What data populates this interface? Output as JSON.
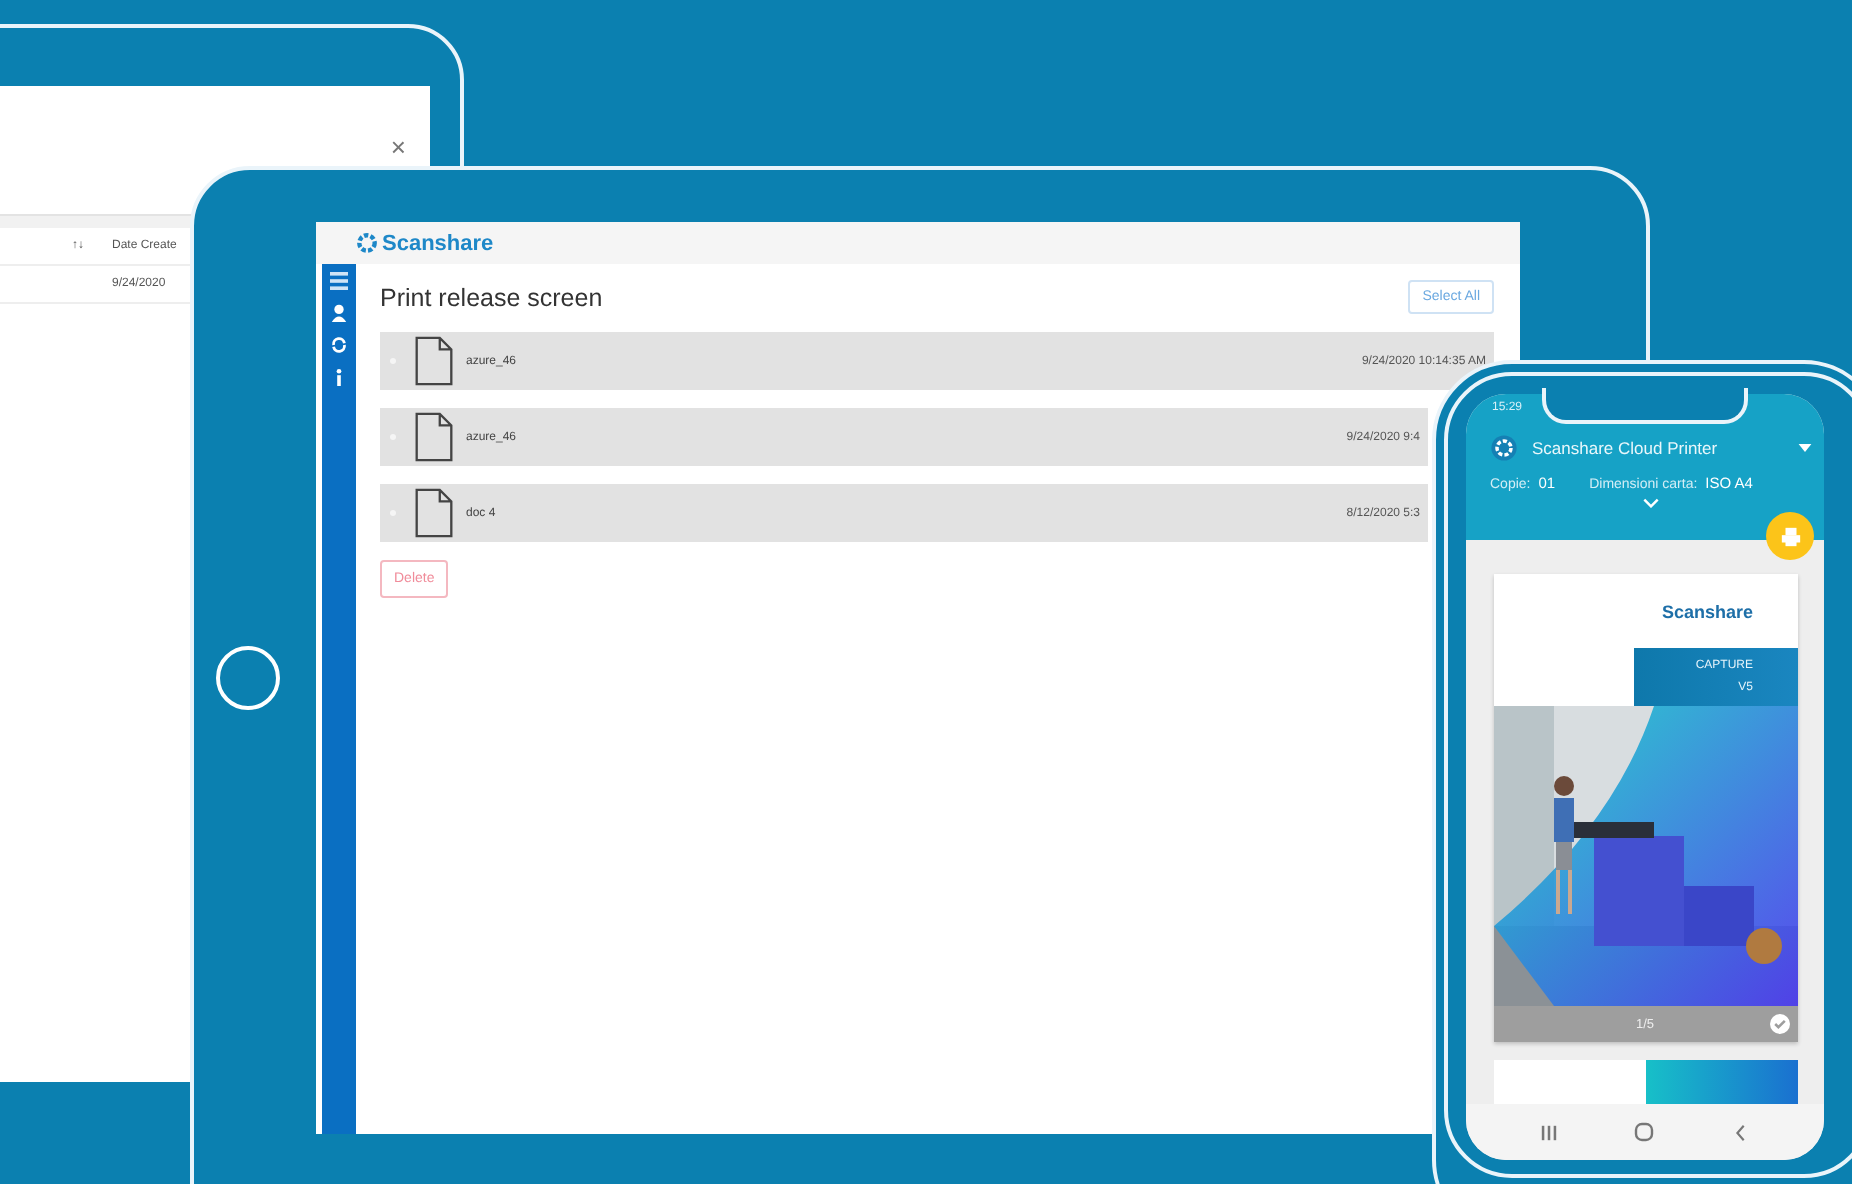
{
  "back_window": {
    "close": "×",
    "columns": [
      {
        "sort": "↑↓",
        "label": "Date Create"
      }
    ],
    "rows": [
      [
        "9/24/2020"
      ]
    ]
  },
  "tablet": {
    "logo": "Scanshare",
    "title": "Print release screen",
    "select_all": "Select All",
    "jobs": [
      {
        "name": "azure_46",
        "date": "9/24/2020 10:14:35 AM",
        "selected": false
      },
      {
        "name": "azure_46",
        "date": "9/24/2020 9:4",
        "selected": false
      },
      {
        "name": "doc 4",
        "date": "8/12/2020 5:3",
        "selected": false
      }
    ],
    "delete": "Delete"
  },
  "phone": {
    "time": "15:29",
    "app_title": "Scanshare Cloud Printer",
    "copies_label": "Copie:",
    "copies": "01",
    "paper_label": "Dimensioni carta:",
    "paper": "ISO A4",
    "page": {
      "logo": "Scanshare",
      "tag": "CAPTURE",
      "version": "V5",
      "indicator": "1/5",
      "checked": true
    }
  }
}
